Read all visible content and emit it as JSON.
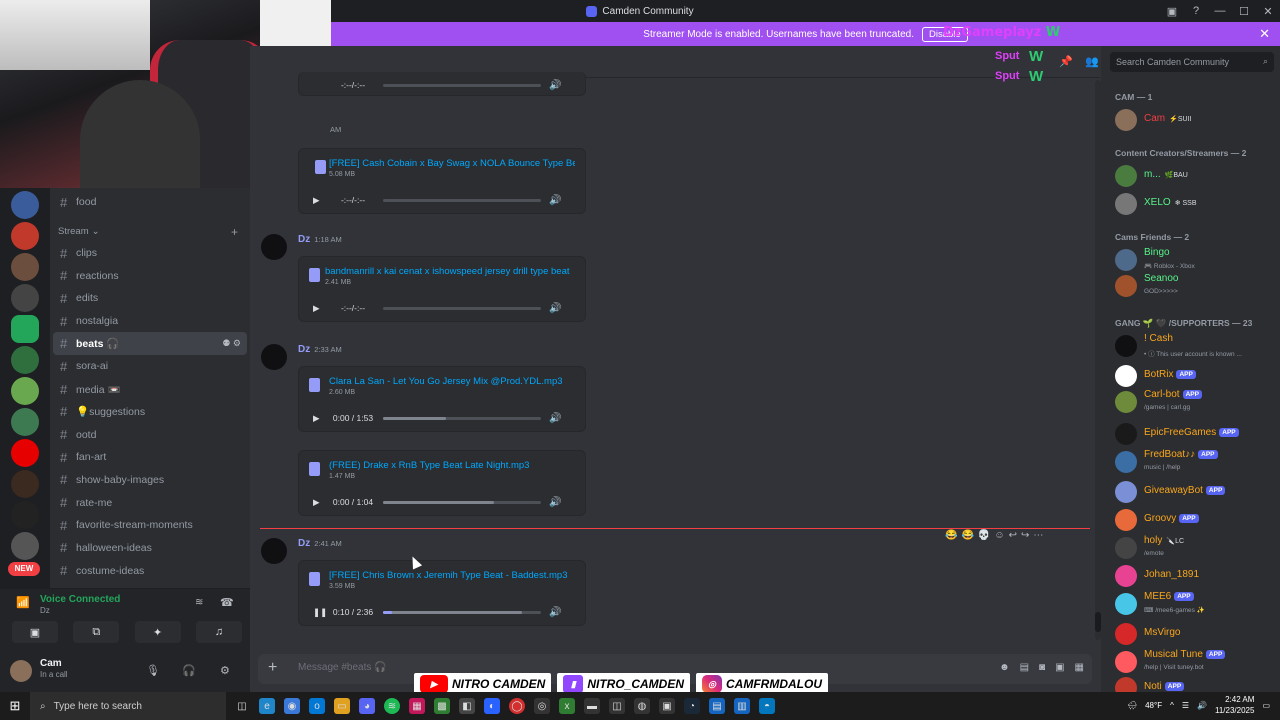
{
  "window": {
    "title": "Camden Community"
  },
  "banner": {
    "text": "Streamer Mode is enabled. Usernames have been truncated.",
    "button": "Disable",
    "overlay_name": "DzGameplayz",
    "overlay_w": "W"
  },
  "overlay": {
    "sput1": "Sput",
    "sput2": "Sput",
    "w": "W"
  },
  "search": {
    "placeholder": "Search Camden Community"
  },
  "channels": {
    "top": [
      {
        "label": "food"
      }
    ],
    "category": "Stream",
    "items": [
      {
        "label": "clips"
      },
      {
        "label": "reactions"
      },
      {
        "label": "edits"
      },
      {
        "label": "nostalgia"
      },
      {
        "label": "beats 🎧"
      },
      {
        "label": "sora-ai"
      },
      {
        "label": "media 📼"
      },
      {
        "label": "💡suggestions"
      },
      {
        "label": "ootd"
      },
      {
        "label": "fan-art"
      },
      {
        "label": "show-baby-images"
      },
      {
        "label": "rate-me"
      },
      {
        "label": "favorite-stream-moments"
      },
      {
        "label": "halloween-ideas"
      },
      {
        "label": "costume-ideas"
      }
    ]
  },
  "new_badge": "NEW",
  "voice": {
    "status": "Voice Connected",
    "server": "Dz"
  },
  "user": {
    "name": "Cam",
    "status": "In a call"
  },
  "messages": {
    "m0": {
      "time": "",
      "file": "",
      "size": "",
      "time_display": "-:--/-:--"
    },
    "m1": {
      "time": "AM",
      "file": "[FREE] Cash Cobain x Bay Swag x NOLA Bounce Type Beat",
      "size": "5.08 MB",
      "time_display": "-:--/-:--"
    },
    "m2": {
      "author": "Dz",
      "time": "1:18 AM",
      "file": "bandmanrill x kai cenat x ishowspeed jersey drill type beat",
      "size": "2.41 MB",
      "time_display": "-:--/-:--"
    },
    "m3": {
      "author": "Dz",
      "time": "2:33 AM",
      "file": "Clara La San - Let You Go Jersey Mix @Prod.YDL.mp3",
      "size": "2.60 MB",
      "time_display": "0:00 / 1:53",
      "progress": 0,
      "buffered": 0.4
    },
    "m4": {
      "file": "(FREE) Drake x RnB Type Beat Late Night.mp3",
      "size": "1.47 MB",
      "time_display": "0:00 / 1:04",
      "progress": 0,
      "buffered": 0.7
    },
    "m5": {
      "author": "Dz",
      "time": "2:41 AM",
      "file": "[FREE] Chris Brown x Jeremih Type Beat - Baddest.mp3",
      "size": "3.59 MB",
      "time_display": "0:10 / 2:36",
      "progress": 0.06,
      "buffered": 0.88
    }
  },
  "composer": {
    "placeholder": "Message #beats 🎧"
  },
  "socials": {
    "yt": "NITRO CAMDEN",
    "tw": "NITRO_CAMDEN",
    "ig": "CAMFRMDALOU"
  },
  "members": {
    "groups": [
      {
        "title": "CAM — 1"
      },
      {
        "title": "Content Creators/Streamers — 2"
      },
      {
        "title": "Cams Friends — 2"
      },
      {
        "title": "GANG 🌱 🖤 /SUPPORTERS — 23"
      }
    ],
    "list": [
      {
        "name": "Cam",
        "badge": "⚡SUII",
        "status": "",
        "app": false,
        "color": "#f23f43"
      },
      {
        "name": "m...",
        "badge": "🌿BAU",
        "status": "",
        "app": false,
        "color": "#57f287"
      },
      {
        "name": "XELO",
        "badge": "❄ SSB",
        "status": "",
        "app": false,
        "color": "#57f287"
      },
      {
        "name": "Bingo",
        "badge": "",
        "status": "🎮 Roblox - Xbox",
        "app": false,
        "color": "#57f287"
      },
      {
        "name": "Seanoo",
        "badge": "",
        "status": "GOD>>>>>",
        "app": false,
        "color": "#57f287"
      },
      {
        "name": "! Cash",
        "badge": "",
        "status": "• ⓘ This user account is known ...",
        "app": false,
        "color": "#faa61a"
      },
      {
        "name": "BotRix",
        "badge": "",
        "status": "",
        "app": true,
        "color": "#faa61a"
      },
      {
        "name": "Carl-bot",
        "badge": "",
        "status": "/games | carl.gg",
        "app": true,
        "color": "#faa61a"
      },
      {
        "name": "EpicFreeGames",
        "badge": "",
        "status": "",
        "app": true,
        "color": "#faa61a"
      },
      {
        "name": "FredBoat♪♪",
        "badge": "",
        "status": "music | /help",
        "app": true,
        "color": "#faa61a"
      },
      {
        "name": "GiveawayBot",
        "badge": "",
        "status": "",
        "app": true,
        "color": "#faa61a"
      },
      {
        "name": "Groovy",
        "badge": "",
        "status": "",
        "app": true,
        "color": "#faa61a"
      },
      {
        "name": "holy",
        "badge": "🔪LC",
        "status": "/emote",
        "app": false,
        "color": "#faa61a"
      },
      {
        "name": "Johan_1891",
        "badge": "",
        "status": "",
        "app": false,
        "color": "#faa61a"
      },
      {
        "name": "MEE6",
        "badge": "",
        "status": "⌨ /mee6-games ✨",
        "app": true,
        "color": "#faa61a"
      },
      {
        "name": "MsVirgo",
        "badge": "",
        "status": "",
        "app": false,
        "color": "#faa61a"
      },
      {
        "name": "Musical Tune",
        "badge": "",
        "status": "/help | Visit tuney.bot",
        "app": true,
        "color": "#faa61a"
      },
      {
        "name": "Noti",
        "badge": "",
        "status": "",
        "app": true,
        "color": "#faa61a"
      }
    ],
    "app_label": "APP"
  },
  "taskbar": {
    "search": "Type here to search",
    "weather": "48°F",
    "time": "2:42 AM",
    "date": "11/23/2025"
  }
}
